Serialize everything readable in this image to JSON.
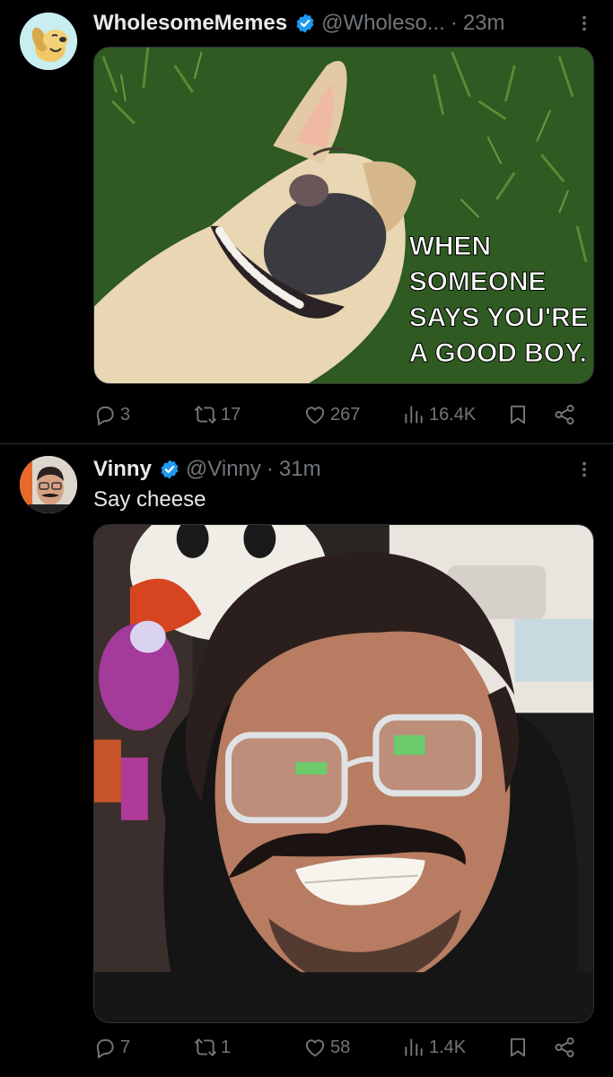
{
  "tweets": [
    {
      "display_name": "WholesomeMemes",
      "handle": "@Wholeso...",
      "dot": "·",
      "time": "23m",
      "text": "",
      "meme_lines": [
        "WHEN",
        "SOMEONE",
        "SAYS YOU'RE",
        "A GOOD BOY."
      ],
      "counts": {
        "replies": "3",
        "reposts": "17",
        "likes": "267",
        "views": "16.4K"
      }
    },
    {
      "display_name": "Vinny",
      "handle": "@Vinny",
      "dot": "·",
      "time": "31m",
      "text": "Say cheese",
      "counts": {
        "replies": "7",
        "reposts": "1",
        "likes": "58",
        "views": "1.4K"
      }
    }
  ],
  "icons": {
    "reply": "reply-icon",
    "repost": "repost-icon",
    "like": "heart-icon",
    "views": "views-icon",
    "bookmark": "bookmark-icon",
    "share": "share-icon",
    "more": "more-icon",
    "verified": "verified-badge-icon"
  },
  "colors": {
    "background": "#000000",
    "text": "#e7e9ea",
    "secondary": "#71767b",
    "verified": "#1d9bf0",
    "divider": "#2f3336"
  }
}
